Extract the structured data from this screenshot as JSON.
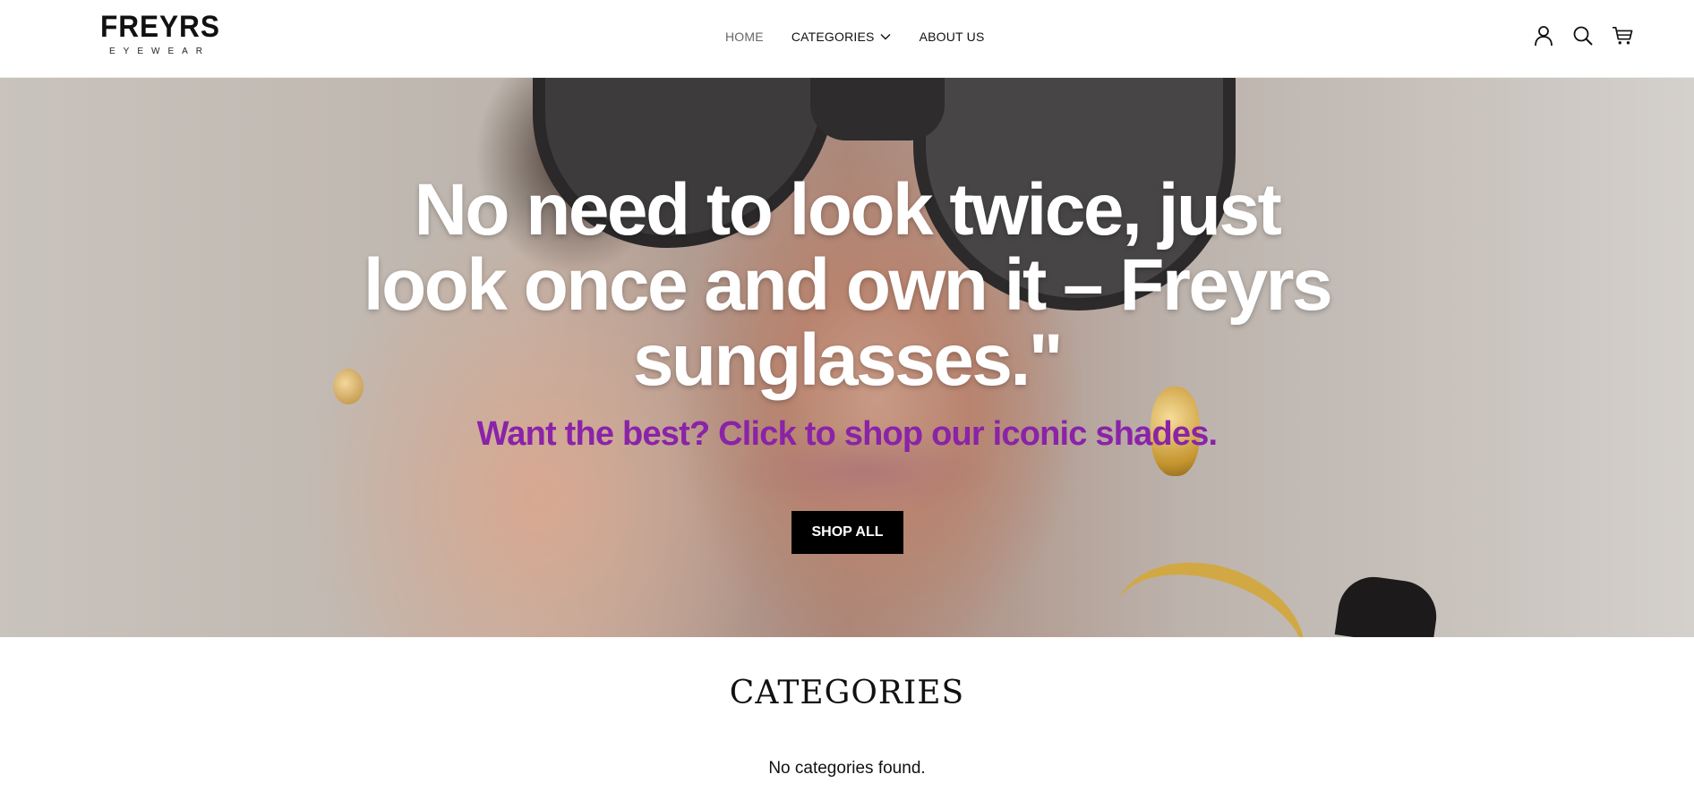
{
  "header": {
    "logo": {
      "main": "FREYRS",
      "sub": "EYEWEAR"
    },
    "nav": [
      {
        "label": "HOME"
      },
      {
        "label": "CATEGORIES"
      },
      {
        "label": "ABOUT US"
      }
    ],
    "icons": [
      "account-icon",
      "search-icon",
      "cart-icon"
    ]
  },
  "hero": {
    "heading": "No need to look twice, just look once and own it – Freyrs sunglasses.\"",
    "subheading": "Want the best? Click to shop our iconic shades.",
    "cta_label": "SHOP ALL",
    "colors": {
      "subheading": "#8a23a8",
      "cta_bg": "#000000",
      "cta_text": "#ffffff"
    }
  },
  "categories": {
    "title": "CATEGORIES",
    "empty_message": "No categories found."
  }
}
